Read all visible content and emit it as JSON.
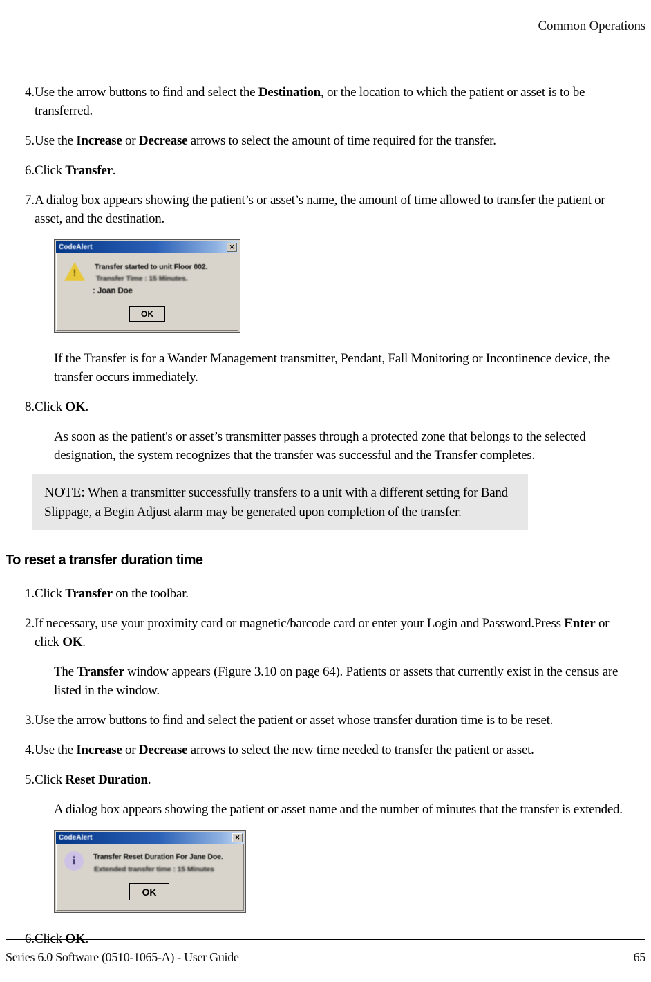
{
  "header": {
    "title": "Common Operations"
  },
  "footer": {
    "left": "Series 6.0 Software (0510-1065-A) - User Guide",
    "page_number": "65"
  },
  "steps_transfer": [
    {
      "num": "4.",
      "parts": [
        {
          "t": "Use the arrow buttons to find and select the ",
          "b": false
        },
        {
          "t": "Destination",
          "b": true
        },
        {
          "t": ", or the location to which the patient or asset is to be transferred.",
          "b": false
        }
      ]
    },
    {
      "num": "5.",
      "parts": [
        {
          "t": "Use the ",
          "b": false
        },
        {
          "t": "Increase",
          "b": true
        },
        {
          "t": " or ",
          "b": false
        },
        {
          "t": "Decrease",
          "b": true
        },
        {
          "t": " arrows to select the amount of time required for the transfer.",
          "b": false
        }
      ]
    },
    {
      "num": "6.",
      "parts": [
        {
          "t": "Click ",
          "b": false
        },
        {
          "t": "Transfer",
          "b": true
        },
        {
          "t": ".",
          "b": false
        }
      ]
    },
    {
      "num": "7.",
      "parts": [
        {
          "t": "A dialog box appears showing the patient’s or asset’s name, the amount of time allowed to transfer the patient or asset, and the destination.",
          "b": false
        }
      ]
    }
  ],
  "para_wander": "If the Transfer is for a Wander Management transmitter, Pendant, Fall Monitoring or Incontinence device, the transfer occurs immediately.",
  "step_8": {
    "num": "8.",
    "parts": [
      {
        "t": "Click ",
        "b": false
      },
      {
        "t": "OK",
        "b": true
      },
      {
        "t": ".",
        "b": false
      }
    ]
  },
  "para_assoon": "As soon as the patient's or asset’s transmitter passes through a protected zone that belongs to the selected designation, the system recognizes that the transfer was successful and the Transfer completes.",
  "note": {
    "label": "NOTE:",
    "text": " When a transmitter successfully transfers to a unit with a different setting for Band Slippage, a Begin Adjust alarm may be generated upon completion of the transfer.",
    "background": "#e7e7e7"
  },
  "section_heading": "To reset a transfer duration time",
  "steps_reset": [
    {
      "num": "1.",
      "parts": [
        {
          "t": "Click ",
          "b": false
        },
        {
          "t": "Transfer",
          "b": true
        },
        {
          "t": " on the toolbar.",
          "b": false
        }
      ]
    },
    {
      "num": "2.",
      "parts": [
        {
          "t": "If necessary, use your proximity card or magnetic/barcode card or enter your Login and Password.Press ",
          "b": false
        },
        {
          "t": "Enter",
          "b": true
        },
        {
          "t": " or click ",
          "b": false
        },
        {
          "t": "OK",
          "b": true
        },
        {
          "t": ".",
          "b": false
        }
      ]
    }
  ],
  "para_transfer_window": [
    {
      "t": "The ",
      "b": false
    },
    {
      "t": "Transfer",
      "b": true
    },
    {
      "t": " window appears (Figure 3.10 on page 64). Patients or assets that currently exist in the census are listed in the window.",
      "b": false
    }
  ],
  "steps_reset_2": [
    {
      "num": "3.",
      "parts": [
        {
          "t": "Use the arrow buttons to find and select the patient or asset whose transfer duration time is to be reset.",
          "b": false
        }
      ]
    },
    {
      "num": "4.",
      "parts": [
        {
          "t": "Use the ",
          "b": false
        },
        {
          "t": "Increase",
          "b": true
        },
        {
          "t": " or ",
          "b": false
        },
        {
          "t": "Decrease",
          "b": true
        },
        {
          "t": " arrows to select the new time needed to transfer the patient or asset.",
          "b": false
        }
      ]
    },
    {
      "num": "5.",
      "parts": [
        {
          "t": "Click ",
          "b": false
        },
        {
          "t": "Reset Duration",
          "b": true
        },
        {
          "t": ".",
          "b": false
        }
      ]
    }
  ],
  "para_dialog_reset": "A dialog box appears showing the patient or asset name and the number of minutes that the transfer is extended.",
  "step_6_final": {
    "num": "6.",
    "parts": [
      {
        "t": "Click ",
        "b": false
      },
      {
        "t": "OK",
        "b": true
      },
      {
        "t": ".",
        "b": false
      }
    ]
  },
  "dialog_transfer_started": {
    "title": "CodeAlert",
    "close_label": "✕",
    "icon": "warning-triangle-icon",
    "lines": [
      "Transfer started to unit Floor 002.",
      "Transfer Time : 15 Minutes.",
      ": Joan Doe"
    ],
    "ok_label": "OK",
    "titlebar_color": "#0b3a87",
    "face_color": "#d4d0c8",
    "icon_color": "#e3c43c"
  },
  "dialog_reset_duration": {
    "title": "CodeAlert",
    "close_label": "✕",
    "icon": "information-icon",
    "lines": [
      "Transfer Reset Duration For Jane Doe.",
      "Extended transfer time : 15 Minutes"
    ],
    "ok_label": "OK",
    "titlebar_color": "#0b3a87",
    "face_color": "#d4d0c8",
    "icon_color": "#c9bfe0"
  }
}
